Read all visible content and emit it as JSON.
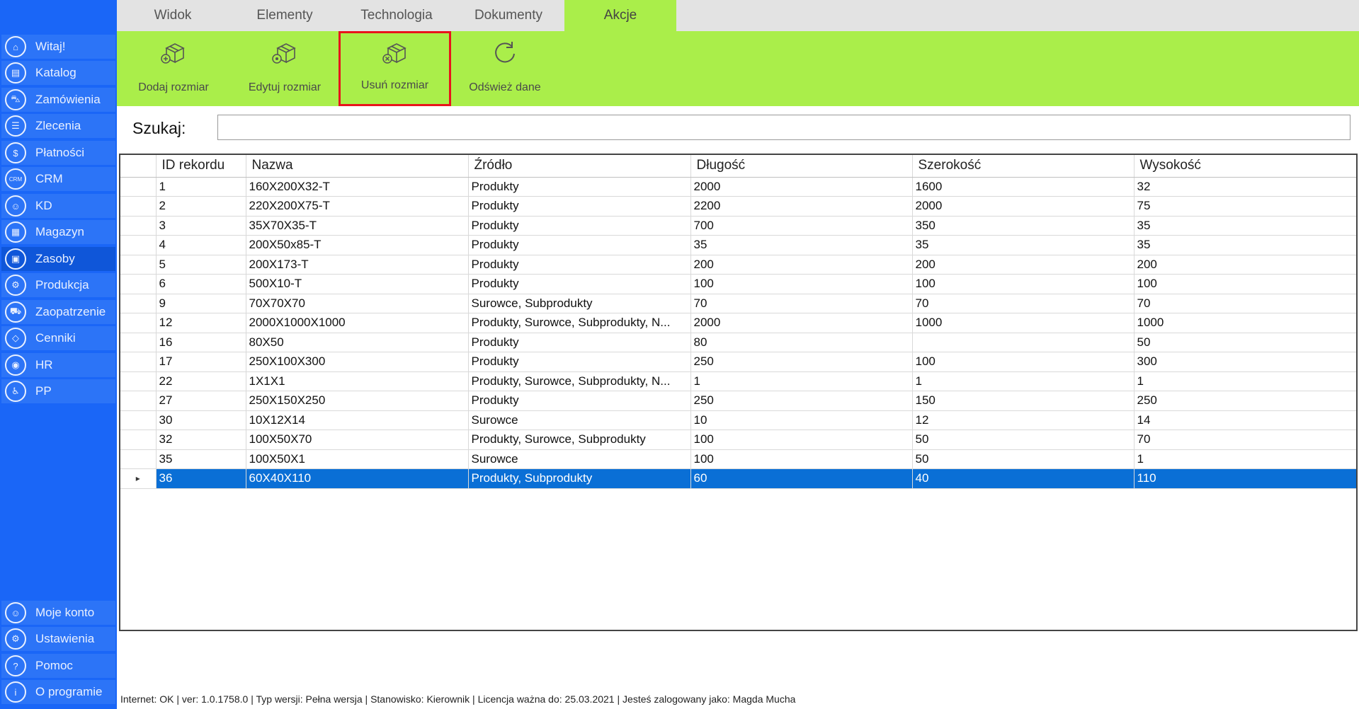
{
  "sidebar": {
    "items": [
      {
        "label": "Witaj!",
        "icon": "home-icon"
      },
      {
        "label": "Katalog",
        "icon": "book-icon"
      },
      {
        "label": "Zamówienia",
        "icon": "cart-icon"
      },
      {
        "label": "Zlecenia",
        "icon": "list-icon"
      },
      {
        "label": "Płatności",
        "icon": "dollar-icon"
      },
      {
        "label": "CRM",
        "icon": "crm-icon"
      },
      {
        "label": "KD",
        "icon": "user-icon"
      },
      {
        "label": "Magazyn",
        "icon": "warehouse-icon"
      },
      {
        "label": "Zasoby",
        "icon": "resources-icon"
      },
      {
        "label": "Produkcja",
        "icon": "production-icon"
      },
      {
        "label": "Zaopatrzenie",
        "icon": "truck-icon"
      },
      {
        "label": "Cenniki",
        "icon": "tag-icon"
      },
      {
        "label": "HR",
        "icon": "hr-icon"
      },
      {
        "label": "PP",
        "icon": "pp-icon"
      }
    ],
    "bottom_items": [
      {
        "label": "Moje konto",
        "icon": "account-icon"
      },
      {
        "label": "Ustawienia",
        "icon": "settings-icon"
      },
      {
        "label": "Pomoc",
        "icon": "help-icon"
      },
      {
        "label": "O programie",
        "icon": "info-icon"
      }
    ]
  },
  "tabs": [
    "Widok",
    "Elementy",
    "Technologia",
    "Dokumenty",
    "Akcje"
  ],
  "active_tab": "Akcje",
  "ribbon": {
    "buttons": [
      {
        "label": "Dodaj rozmiar",
        "icon": "add-size-icon"
      },
      {
        "label": "Edytuj rozmiar",
        "icon": "edit-size-icon"
      },
      {
        "label": "Usuń rozmiar",
        "icon": "delete-size-icon"
      },
      {
        "label": "Odśwież dane",
        "icon": "refresh-icon"
      }
    ]
  },
  "search": {
    "label": "Szukaj:",
    "value": ""
  },
  "table": {
    "columns": [
      "ID rekordu",
      "Nazwa",
      "Źródło",
      "Długość",
      "Szerokość",
      "Wysokość"
    ],
    "rows": [
      [
        "1",
        "160X200X32-T",
        "Produkty",
        "2000",
        "1600",
        "32"
      ],
      [
        "2",
        "220X200X75-T",
        "Produkty",
        "2200",
        "2000",
        "75"
      ],
      [
        "3",
        "35X70X35-T",
        "Produkty",
        "700",
        "350",
        "35"
      ],
      [
        "4",
        "200X50x85-T",
        "Produkty",
        "35",
        "35",
        "35"
      ],
      [
        "5",
        "200X173-T",
        "Produkty",
        "200",
        "200",
        "200"
      ],
      [
        "6",
        "500X10-T",
        "Produkty",
        "100",
        "100",
        "100"
      ],
      [
        "9",
        "70X70X70",
        "Surowce, Subprodukty",
        "70",
        "70",
        "70"
      ],
      [
        "12",
        "2000X1000X1000",
        "Produkty, Surowce, Subprodukty, N...",
        "2000",
        "1000",
        "1000"
      ],
      [
        "16",
        "80X50",
        "Produkty",
        "80",
        "",
        "50"
      ],
      [
        "17",
        "250X100X300",
        "Produkty",
        "250",
        "100",
        "300"
      ],
      [
        "22",
        "1X1X1",
        "Produkty, Surowce, Subprodukty, N...",
        "1",
        "1",
        "1"
      ],
      [
        "27",
        "250X150X250",
        "Produkty",
        "250",
        "150",
        "250"
      ],
      [
        "30",
        "10X12X14",
        "Surowce",
        "10",
        "12",
        "14"
      ],
      [
        "32",
        "100X50X70",
        "Produkty, Surowce, Subprodukty",
        "100",
        "50",
        "70"
      ],
      [
        "35",
        "100X50X1",
        "Surowce",
        "100",
        "50",
        "1"
      ],
      [
        "36",
        "60X40X110",
        "Produkty, Subprodukty",
        "60",
        "40",
        "110"
      ]
    ],
    "selected_row_index": 15,
    "row_marker": "▸"
  },
  "status": {
    "internet": "Internet: OK",
    "version": "ver: 1.0.1758.0",
    "version_type": "Typ wersji: Pełna wersja",
    "station": "Stanowisko: Kierownik",
    "license": "Licencja ważna do: 25.03.2021",
    "user": "Jesteś zalogowany jako: Magda Mucha",
    "separator": "|"
  },
  "colors": {
    "sidebar": "#1a66f7",
    "ribbon": "#aaee4a",
    "selection": "#0a6fd6",
    "highlight_border": "#e8141c"
  }
}
